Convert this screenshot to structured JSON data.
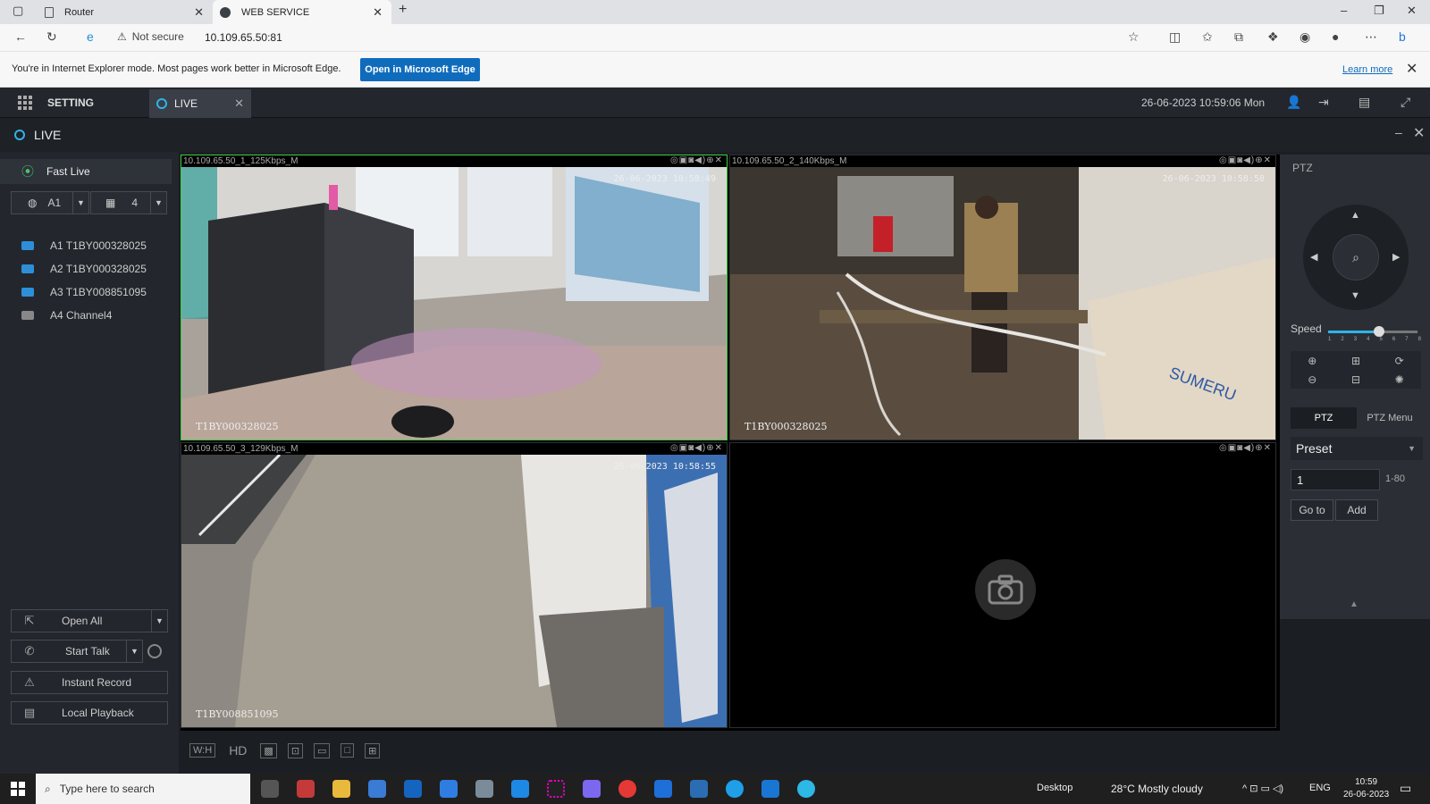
{
  "browser": {
    "tabs": [
      {
        "label": "Router"
      },
      {
        "label": "WEB SERVICE"
      }
    ],
    "address": {
      "security": "Not secure",
      "url": "10.109.65.50:81"
    },
    "ie_bar": {
      "message": "You're in Internet Explorer mode. Most pages work better in Microsoft Edge.",
      "button": "Open in Microsoft Edge",
      "learn_more": "Learn more"
    }
  },
  "app": {
    "setting_label": "SETTING",
    "live_tab_label": "LIVE",
    "datetime": "26-06-2023 10:59:06 Mon",
    "live_bar_label": "LIVE"
  },
  "left": {
    "fast_live": "Fast Live",
    "user_select": "A1",
    "split_select": "4",
    "channels": [
      {
        "label": "A1 T1BY000328025",
        "status": "online"
      },
      {
        "label": "A2 T1BY000328025",
        "status": "online"
      },
      {
        "label": "A3 T1BY008851095",
        "status": "online"
      },
      {
        "label": "A4 Channel4",
        "status": "offline"
      }
    ],
    "actions": {
      "open_all": "Open All",
      "start_talk": "Start Talk",
      "instant_record": "Instant Record",
      "local_playback": "Local Playback"
    }
  },
  "video": {
    "cells": [
      {
        "title": "10.109.65.50_1_125Kbps_M",
        "stamp": "26-06-2023 10:58:49",
        "camera": "T1BY000328025"
      },
      {
        "title": "10.109.65.50_2_140Kbps_M",
        "stamp": "26-06-2023 10:58:58",
        "camera": "T1BY000328025"
      },
      {
        "title": "10.109.65.50_3_129Kbps_M",
        "stamp": "26-06-2023 10:58:55",
        "camera": "T1BY008851095"
      },
      {
        "title": "",
        "stamp": "",
        "camera": ""
      }
    ],
    "bottom_tools": {
      "wh": "W:H",
      "hd": "HD"
    }
  },
  "ptz": {
    "header": "PTZ",
    "speed_label": "Speed",
    "speed_level": 5,
    "speed_max": 8,
    "speed_ticks": [
      "1",
      "2",
      "3",
      "4",
      "5",
      "6",
      "7",
      "8"
    ],
    "tabs": [
      "PTZ",
      "PTZ Menu"
    ],
    "preset_label": "Preset",
    "preset_value": "1",
    "preset_range": "1-80",
    "goto": "Go to",
    "add": "Add"
  },
  "taskbar": {
    "search_placeholder": "Type here to search",
    "desktop": "Desktop",
    "weather": "28°C  Mostly cloudy",
    "lang": "ENG",
    "time": "10:59",
    "date": "26-06-2023"
  }
}
